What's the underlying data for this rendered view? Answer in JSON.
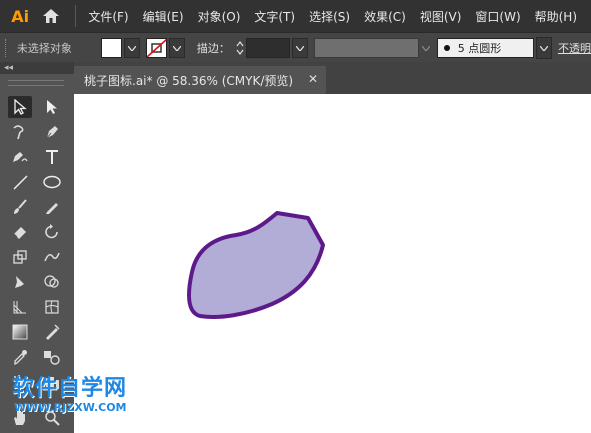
{
  "app": {
    "logo_text": "Ai",
    "icon": "home-icon"
  },
  "menu": {
    "items": [
      "文件(F)",
      "编辑(E)",
      "对象(O)",
      "文字(T)",
      "选择(S)",
      "效果(C)",
      "视图(V)",
      "窗口(W)",
      "帮助(H)"
    ]
  },
  "control_bar": {
    "selection_status": "未选择对象",
    "fill_color": "#ffffff",
    "stroke_color": "none",
    "stroke_label": "描边：",
    "stroke_value": "",
    "brush": "5 点圆形",
    "opacity_label": "不透明"
  },
  "tools_panel": {
    "collapse_label": "◂◂"
  },
  "document": {
    "tab_title": "桃子图标.ai* @ 58.36% (CMYK/预览)",
    "close_glyph": "✕"
  },
  "canvas": {
    "shape_fill": "#b1add6",
    "shape_stroke": "#5e1a8a"
  },
  "watermark": {
    "title": "软件自学网",
    "url": "WWW.RJZXW.COM"
  }
}
